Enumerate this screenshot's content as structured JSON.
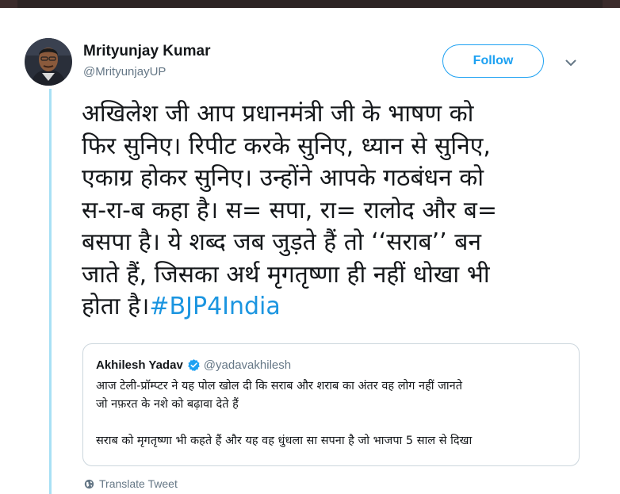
{
  "tweet": {
    "author": {
      "name": "Mrityunjay Kumar",
      "handle": "@MrityunjayUP"
    },
    "follow_label": "Follow",
    "text_lines": [
      "अखिलेश जी आप प्रधानमंत्री जी के भाषण को",
      "फिर सुनिए। रिपीट करके सुनिए, ध्यान से सुनिए,",
      "एकाग्र होकर सुनिए। उन्होंने आपके गठबंधन को",
      "स-रा-ब कहा है। स= सपा, रा= रालोद और ब=",
      "बसपा है। ये शब्द जब जुड़ते हैं तो ‘‘सराब’’ बन",
      "जाते हैं, जिसका अर्थ मृगतृष्णा ही नहीं धोखा भी"
    ],
    "last_line_text": "होता है।",
    "hashtag": "#BJP4India",
    "translate_label": "Translate Tweet"
  },
  "quote": {
    "name": "Akhilesh Yadav",
    "handle": "@yadavakhilesh",
    "lines": [
      "आज टेली-प्रॉम्प्टर ने यह पोल खोल दी कि सराब और शराब का अंतर वह लोग नहीं जानते",
      "जो नफ़रत के नशे को बढ़ावा देते हैं",
      "",
      "सराब को मृगतृष्णा भी कहते हैं और यह वह धुंधला सा सपना है जो भाजपा 5 साल से दिखा"
    ]
  },
  "colors": {
    "accent": "#1da1f2",
    "hashtag": "#1b95e0",
    "thread_line": "#a8e0f5",
    "secondary_text": "#657786"
  },
  "icons": {
    "caret": "chevron-down-icon",
    "verified": "verified-badge-icon",
    "translate": "globe-icon"
  }
}
